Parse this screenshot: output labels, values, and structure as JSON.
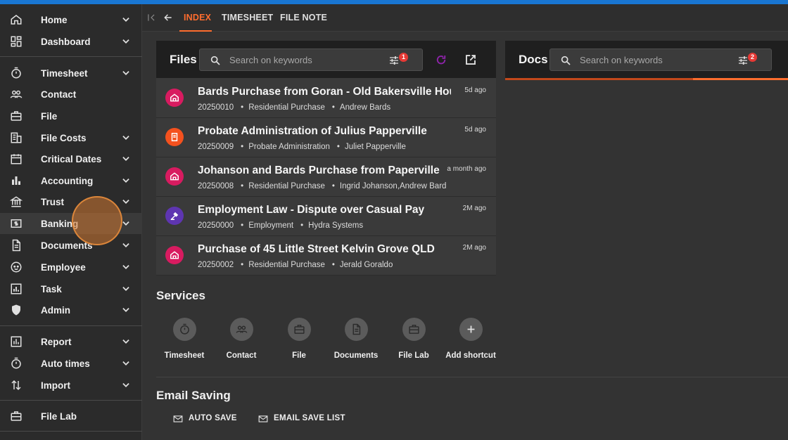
{
  "sidebar": {
    "items": [
      {
        "label": "Home",
        "icon": "home-icon"
      },
      {
        "label": "Dashboard",
        "icon": "dashboard-icon"
      },
      {
        "label": "Timesheet",
        "icon": "timer-icon"
      },
      {
        "label": "Contact",
        "icon": "people-icon"
      },
      {
        "label": "File",
        "icon": "briefcase-icon"
      },
      {
        "label": "File Costs",
        "icon": "building-icon"
      },
      {
        "label": "Critical Dates",
        "icon": "calendar-icon"
      },
      {
        "label": "Accounting",
        "icon": "bar-chart-icon"
      },
      {
        "label": "Trust",
        "icon": "bank-icon"
      },
      {
        "label": "Banking",
        "icon": "money-icon"
      },
      {
        "label": "Documents",
        "icon": "document-icon"
      },
      {
        "label": "Employee",
        "icon": "face-icon"
      },
      {
        "label": "Task",
        "icon": "task-chart-icon"
      },
      {
        "label": "Admin",
        "icon": "shield-icon"
      },
      {
        "label": "Report",
        "icon": "report-icon"
      },
      {
        "label": "Auto times",
        "icon": "timer-icon"
      },
      {
        "label": "Import",
        "icon": "import-icon"
      },
      {
        "label": "File Lab",
        "icon": "briefcase-icon"
      }
    ]
  },
  "tabs": [
    {
      "label": "INDEX",
      "active": true
    },
    {
      "label": "TIMESHEET",
      "active": false
    },
    {
      "label": "FILE NOTE",
      "active": false
    }
  ],
  "files": {
    "title": "Files",
    "search_placeholder": "Search on keywords",
    "filter_badge": "1",
    "rows": [
      {
        "title": "Bards Purchase from Goran - Old Bakersville House",
        "number": "20250010",
        "type": "Residential Purchase",
        "client": "Andrew Bards",
        "age": "5d ago",
        "icon": "house-icon",
        "color": "#d81b60"
      },
      {
        "title": "Probate Administration of Julius Papperville",
        "number": "20250009",
        "type": "Probate Administration",
        "client": "Juliet Papperville",
        "age": "5d ago",
        "icon": "scroll-icon",
        "color": "#f4511e"
      },
      {
        "title": "Johanson and Bards Purchase from Paperville",
        "number": "20250008",
        "type": "Residential Purchase",
        "client": "Ingrid Johanson,Andrew Bard",
        "age": "a month ago",
        "icon": "house-icon",
        "color": "#d81b60"
      },
      {
        "title": "Employment Law - Dispute over Casual Pay",
        "number": "20250000",
        "type": "Employment",
        "client": "Hydra Systems",
        "age": "2M ago",
        "icon": "gavel-icon",
        "color": "#5e35b1"
      },
      {
        "title": "Purchase of 45 Little Street Kelvin Grove QLD",
        "number": "20250002",
        "type": "Residential Purchase",
        "client": "Jerald Goraldo",
        "age": "2M ago",
        "icon": "house-icon",
        "color": "#d81b60"
      }
    ]
  },
  "docs": {
    "title": "Docs",
    "search_placeholder": "Search on keywords",
    "filter_badge": "2"
  },
  "services": {
    "title": "Services",
    "items": [
      {
        "label": "Timesheet",
        "icon": "timer-icon"
      },
      {
        "label": "Contact",
        "icon": "people-icon"
      },
      {
        "label": "File",
        "icon": "briefcase-icon"
      },
      {
        "label": "Documents",
        "icon": "document-icon"
      },
      {
        "label": "File Lab",
        "icon": "briefcase-icon"
      },
      {
        "label": "Add shortcut",
        "icon": "plus-icon"
      }
    ]
  },
  "email_saving": {
    "title": "Email Saving",
    "auto_save": "AUTO SAVE",
    "save_list": "EMAIL SAVE LIST"
  },
  "colors": {
    "accent": "#ff6d2e",
    "badge": "#e53935",
    "topbar": "#1976d2"
  }
}
